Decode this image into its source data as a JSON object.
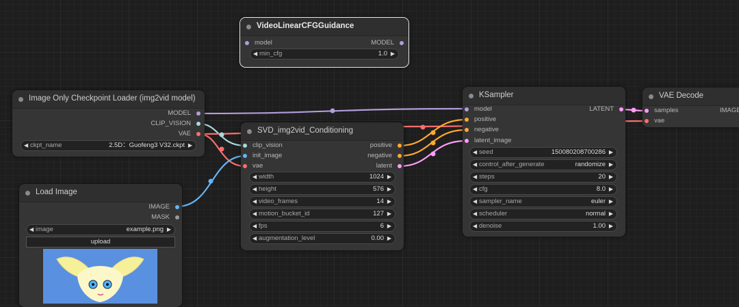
{
  "colors": {
    "model": "#b39ddb",
    "clip_vision": "#a8dadc",
    "vae": "#ff6e6e",
    "image": "#64b5f6",
    "mask": "#81c784",
    "conditioning": "#ffa931",
    "latent": "#ff9cf9",
    "gray": "#9a9a9a"
  },
  "nodes": {
    "guidance": {
      "title": "VideoLinearCFGGuidance",
      "in_model": "model",
      "out_model": "MODEL",
      "w_min_cfg_label": "min_cfg",
      "w_min_cfg_value": "1.0"
    },
    "ckpt": {
      "title": "Image Only Checkpoint Loader (img2vid model)",
      "out_model": "MODEL",
      "out_clip": "CLIP_VISION",
      "out_vae": "VAE",
      "w_ckpt_label": "ckpt_name",
      "w_ckpt_value": "2.5D：Guofeng3 V32.ckpt"
    },
    "load": {
      "title": "Load Image",
      "out_image": "IMAGE",
      "out_mask": "MASK",
      "w_image_label": "image",
      "w_image_value": "example.png",
      "upload_label": "upload"
    },
    "svd": {
      "title": "SVD_img2vid_Conditioning",
      "in_clip": "clip_vision",
      "in_init": "init_image",
      "in_vae": "vae",
      "out_pos": "positive",
      "out_neg": "negative",
      "out_lat": "latent",
      "widgets": [
        {
          "label": "width",
          "value": "1024"
        },
        {
          "label": "height",
          "value": "576"
        },
        {
          "label": "video_frames",
          "value": "14"
        },
        {
          "label": "motion_bucket_id",
          "value": "127"
        },
        {
          "label": "fps",
          "value": "6"
        },
        {
          "label": "augmentation_level",
          "value": "0.00"
        }
      ]
    },
    "ksampler": {
      "title": "KSampler",
      "in_model": "model",
      "in_pos": "positive",
      "in_neg": "negative",
      "in_lat": "latent_image",
      "out_latent": "LATENT",
      "widgets": [
        {
          "label": "seed",
          "value": "150080208700286"
        },
        {
          "label": "control_after_generate",
          "value": "randomize"
        },
        {
          "label": "steps",
          "value": "20"
        },
        {
          "label": "cfg",
          "value": "8.0"
        },
        {
          "label": "sampler_name",
          "value": "euler"
        },
        {
          "label": "scheduler",
          "value": "normal"
        },
        {
          "label": "denoise",
          "value": "1.00"
        }
      ]
    },
    "vae": {
      "title": "VAE Decode",
      "in_samples": "samples",
      "in_vae": "vae",
      "out_image": "IMAGE"
    }
  }
}
